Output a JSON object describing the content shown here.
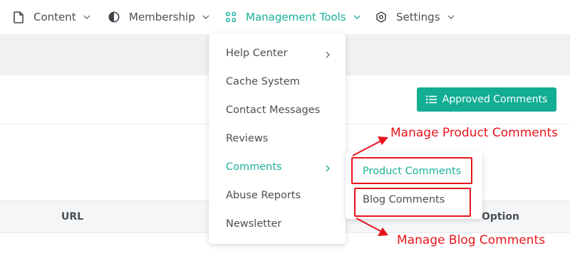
{
  "nav": {
    "items": [
      {
        "label": "Content",
        "icon": "document-icon"
      },
      {
        "label": "Membership",
        "icon": "contrast-icon"
      },
      {
        "label": "Management Tools",
        "icon": "grid-icon"
      },
      {
        "label": "Settings",
        "icon": "gear-icon"
      }
    ]
  },
  "toolbar": {
    "approved_label": "Approved Comments"
  },
  "table": {
    "columns": [
      "URL",
      "Option"
    ]
  },
  "dropdown": {
    "items": [
      {
        "label": "Help Center",
        "has_submenu": true
      },
      {
        "label": "Cache System",
        "has_submenu": false
      },
      {
        "label": "Contact Messages",
        "has_submenu": false
      },
      {
        "label": "Reviews",
        "has_submenu": false
      },
      {
        "label": "Comments",
        "has_submenu": true
      },
      {
        "label": "Abuse Reports",
        "has_submenu": false
      },
      {
        "label": "Newsletter",
        "has_submenu": false
      }
    ]
  },
  "submenu": {
    "items": [
      {
        "label": "Product Comments"
      },
      {
        "label": "Blog Comments"
      }
    ]
  },
  "annotations": {
    "product": "Manage Product Comments",
    "blog": "Manage Blog Comments"
  },
  "colors": {
    "accent": "#1aaf98",
    "button": "#13ad93",
    "annotation": "#e8141b"
  }
}
